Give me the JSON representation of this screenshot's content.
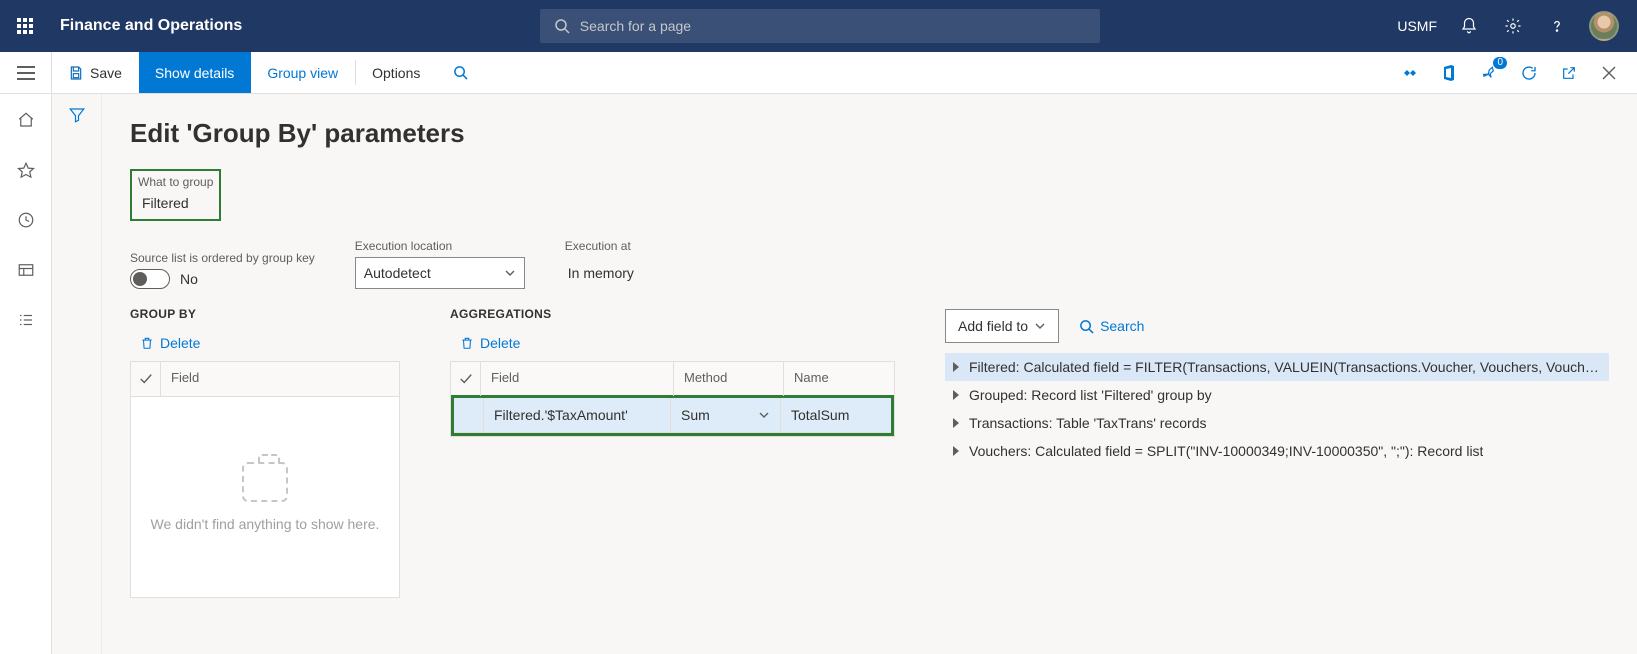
{
  "top": {
    "appTitle": "Finance and Operations",
    "searchPlaceholder": "Search for a page",
    "company": "USMF"
  },
  "cmd": {
    "save": "Save",
    "showDetails": "Show details",
    "groupView": "Group view",
    "options": "Options",
    "badge": "0"
  },
  "page": {
    "title": "Edit 'Group By' parameters"
  },
  "fields": {
    "whatToGroupLabel": "What to group",
    "whatToGroupValue": "Filtered",
    "orderedLabel": "Source list is ordered by group key",
    "orderedValue": "No",
    "execLocLabel": "Execution location",
    "execLocValue": "Autodetect",
    "execAtLabel": "Execution at",
    "execAtValue": "In memory"
  },
  "groupBy": {
    "heading": "GROUP BY",
    "delete": "Delete",
    "headerField": "Field",
    "emptyText": "We didn't find anything to show here."
  },
  "aggregations": {
    "heading": "AGGREGATIONS",
    "delete": "Delete",
    "headers": {
      "field": "Field",
      "method": "Method",
      "name": "Name"
    },
    "rows": [
      {
        "field": "Filtered.'$TaxAmount'",
        "method": "Sum",
        "name": "TotalSum"
      }
    ]
  },
  "rightPanel": {
    "addFieldTo": "Add field to",
    "search": "Search",
    "items": [
      "Filtered: Calculated field = FILTER(Transactions, VALUEIN(Transactions.Voucher, Vouchers, Vouchers.Value))",
      "Grouped: Record list 'Filtered' group by",
      "Transactions: Table 'TaxTrans' records",
      "Vouchers: Calculated field = SPLIT(\"INV-10000349;INV-10000350\", \";\"): Record list"
    ]
  }
}
